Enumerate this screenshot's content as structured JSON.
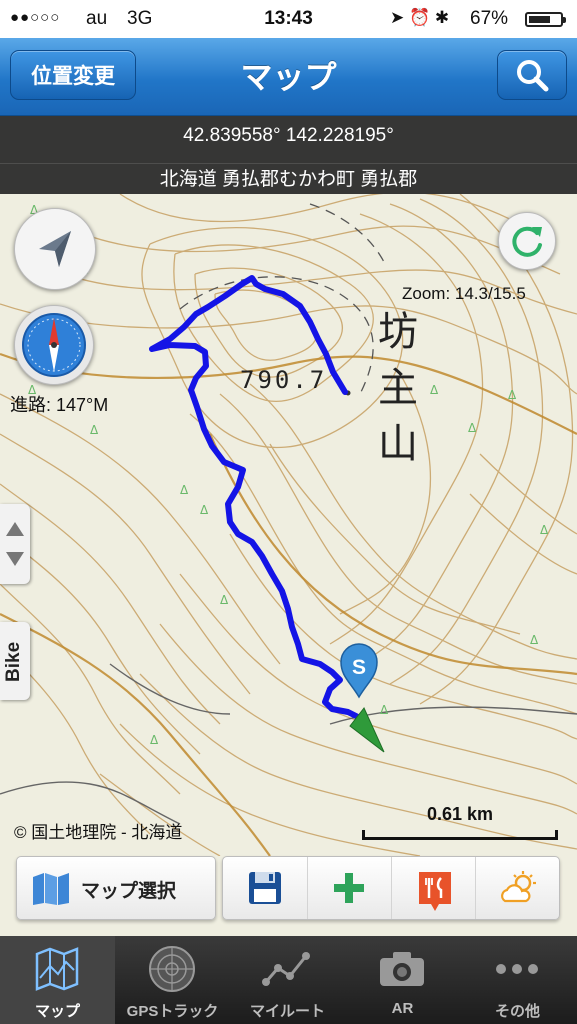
{
  "status_bar": {
    "signal": "●●○○○",
    "carrier": "au",
    "network": "3G",
    "time": "13:43",
    "battery": "67%"
  },
  "nav": {
    "left_button": "位置変更",
    "title": "マップ",
    "search_icon": "search-icon"
  },
  "info": {
    "coordinates": "42.839558° 142.228195°",
    "address": "北海道 勇払郡むかわ町 勇払郡"
  },
  "map": {
    "heading": "進路: 147°M",
    "zoom": "Zoom: 14.3/15.5",
    "elevation_label": "790.7",
    "mountain_name": [
      "坊",
      "主",
      "山"
    ],
    "copyright": "© 国土地理院 - 北海道",
    "scale": "0.61 km",
    "start_marker": "S",
    "side_tab": "Bike",
    "track_color": "#1414e6"
  },
  "toolbar": {
    "map_select_label": "マップ選択",
    "actions": [
      "save-icon",
      "add-icon",
      "restaurant-icon",
      "weather-icon"
    ]
  },
  "tabbar": {
    "tabs": [
      {
        "label": "マップ",
        "icon": "map-icon",
        "active": true
      },
      {
        "label": "GPSトラック",
        "icon": "radar-icon",
        "active": false
      },
      {
        "label": "マイルート",
        "icon": "route-icon",
        "active": false
      },
      {
        "label": "AR",
        "icon": "camera-icon",
        "active": false
      },
      {
        "label": "その他",
        "icon": "more-icon",
        "active": false
      }
    ]
  },
  "colors": {
    "nav_blue": "#2176c8",
    "contour": "#c9a46a",
    "track": "#1414e6",
    "start_pin": "#3a8fd8",
    "current_position": "#2f9a3a"
  }
}
